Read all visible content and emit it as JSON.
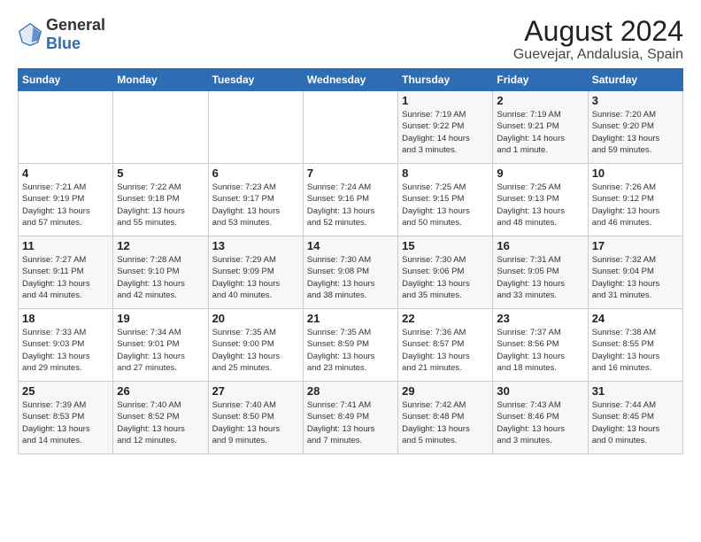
{
  "logo": {
    "general": "General",
    "blue": "Blue"
  },
  "title": "August 2024",
  "subtitle": "Guevejar, Andalusia, Spain",
  "headers": [
    "Sunday",
    "Monday",
    "Tuesday",
    "Wednesday",
    "Thursday",
    "Friday",
    "Saturday"
  ],
  "weeks": [
    [
      {
        "day": "",
        "content": ""
      },
      {
        "day": "",
        "content": ""
      },
      {
        "day": "",
        "content": ""
      },
      {
        "day": "",
        "content": ""
      },
      {
        "day": "1",
        "content": "Sunrise: 7:19 AM\nSunset: 9:22 PM\nDaylight: 14 hours\nand 3 minutes."
      },
      {
        "day": "2",
        "content": "Sunrise: 7:19 AM\nSunset: 9:21 PM\nDaylight: 14 hours\nand 1 minute."
      },
      {
        "day": "3",
        "content": "Sunrise: 7:20 AM\nSunset: 9:20 PM\nDaylight: 13 hours\nand 59 minutes."
      }
    ],
    [
      {
        "day": "4",
        "content": "Sunrise: 7:21 AM\nSunset: 9:19 PM\nDaylight: 13 hours\nand 57 minutes."
      },
      {
        "day": "5",
        "content": "Sunrise: 7:22 AM\nSunset: 9:18 PM\nDaylight: 13 hours\nand 55 minutes."
      },
      {
        "day": "6",
        "content": "Sunrise: 7:23 AM\nSunset: 9:17 PM\nDaylight: 13 hours\nand 53 minutes."
      },
      {
        "day": "7",
        "content": "Sunrise: 7:24 AM\nSunset: 9:16 PM\nDaylight: 13 hours\nand 52 minutes."
      },
      {
        "day": "8",
        "content": "Sunrise: 7:25 AM\nSunset: 9:15 PM\nDaylight: 13 hours\nand 50 minutes."
      },
      {
        "day": "9",
        "content": "Sunrise: 7:25 AM\nSunset: 9:13 PM\nDaylight: 13 hours\nand 48 minutes."
      },
      {
        "day": "10",
        "content": "Sunrise: 7:26 AM\nSunset: 9:12 PM\nDaylight: 13 hours\nand 46 minutes."
      }
    ],
    [
      {
        "day": "11",
        "content": "Sunrise: 7:27 AM\nSunset: 9:11 PM\nDaylight: 13 hours\nand 44 minutes."
      },
      {
        "day": "12",
        "content": "Sunrise: 7:28 AM\nSunset: 9:10 PM\nDaylight: 13 hours\nand 42 minutes."
      },
      {
        "day": "13",
        "content": "Sunrise: 7:29 AM\nSunset: 9:09 PM\nDaylight: 13 hours\nand 40 minutes."
      },
      {
        "day": "14",
        "content": "Sunrise: 7:30 AM\nSunset: 9:08 PM\nDaylight: 13 hours\nand 38 minutes."
      },
      {
        "day": "15",
        "content": "Sunrise: 7:30 AM\nSunset: 9:06 PM\nDaylight: 13 hours\nand 35 minutes."
      },
      {
        "day": "16",
        "content": "Sunrise: 7:31 AM\nSunset: 9:05 PM\nDaylight: 13 hours\nand 33 minutes."
      },
      {
        "day": "17",
        "content": "Sunrise: 7:32 AM\nSunset: 9:04 PM\nDaylight: 13 hours\nand 31 minutes."
      }
    ],
    [
      {
        "day": "18",
        "content": "Sunrise: 7:33 AM\nSunset: 9:03 PM\nDaylight: 13 hours\nand 29 minutes."
      },
      {
        "day": "19",
        "content": "Sunrise: 7:34 AM\nSunset: 9:01 PM\nDaylight: 13 hours\nand 27 minutes."
      },
      {
        "day": "20",
        "content": "Sunrise: 7:35 AM\nSunset: 9:00 PM\nDaylight: 13 hours\nand 25 minutes."
      },
      {
        "day": "21",
        "content": "Sunrise: 7:35 AM\nSunset: 8:59 PM\nDaylight: 13 hours\nand 23 minutes."
      },
      {
        "day": "22",
        "content": "Sunrise: 7:36 AM\nSunset: 8:57 PM\nDaylight: 13 hours\nand 21 minutes."
      },
      {
        "day": "23",
        "content": "Sunrise: 7:37 AM\nSunset: 8:56 PM\nDaylight: 13 hours\nand 18 minutes."
      },
      {
        "day": "24",
        "content": "Sunrise: 7:38 AM\nSunset: 8:55 PM\nDaylight: 13 hours\nand 16 minutes."
      }
    ],
    [
      {
        "day": "25",
        "content": "Sunrise: 7:39 AM\nSunset: 8:53 PM\nDaylight: 13 hours\nand 14 minutes."
      },
      {
        "day": "26",
        "content": "Sunrise: 7:40 AM\nSunset: 8:52 PM\nDaylight: 13 hours\nand 12 minutes."
      },
      {
        "day": "27",
        "content": "Sunrise: 7:40 AM\nSunset: 8:50 PM\nDaylight: 13 hours\nand 9 minutes."
      },
      {
        "day": "28",
        "content": "Sunrise: 7:41 AM\nSunset: 8:49 PM\nDaylight: 13 hours\nand 7 minutes."
      },
      {
        "day": "29",
        "content": "Sunrise: 7:42 AM\nSunset: 8:48 PM\nDaylight: 13 hours\nand 5 minutes."
      },
      {
        "day": "30",
        "content": "Sunrise: 7:43 AM\nSunset: 8:46 PM\nDaylight: 13 hours\nand 3 minutes."
      },
      {
        "day": "31",
        "content": "Sunrise: 7:44 AM\nSunset: 8:45 PM\nDaylight: 13 hours\nand 0 minutes."
      }
    ]
  ]
}
